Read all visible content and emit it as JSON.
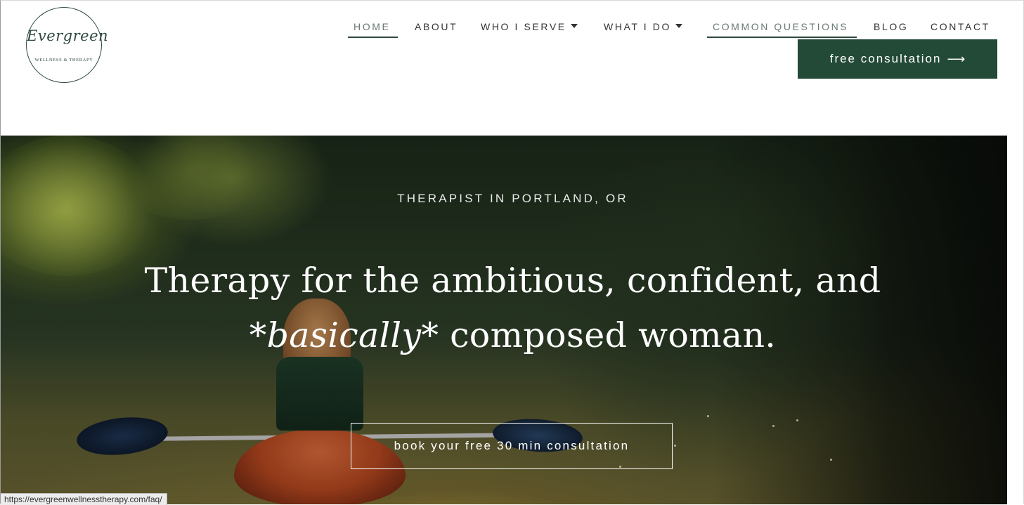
{
  "logo": {
    "script": "Evergreen",
    "subtitle": "WELLNESS & THERAPY"
  },
  "nav": {
    "items": [
      {
        "label": "HOME"
      },
      {
        "label": "ABOUT"
      },
      {
        "label": "WHO I SERVE"
      },
      {
        "label": "WHAT I DO"
      },
      {
        "label": "COMMON QUESTIONS"
      },
      {
        "label": "BLOG"
      },
      {
        "label": "CONTACT"
      }
    ],
    "cta_label": "free consultation",
    "cta_arrow": "⟶"
  },
  "hero": {
    "eyebrow": "THERAPIST IN PORTLAND, OR",
    "title_line1": "Therapy for the ambitious, confident, and",
    "title_line2_prefix": "*",
    "title_line2_emph": "basically",
    "title_line2_suffix": "* composed woman.",
    "button_label": "book your free 30 min consultation"
  },
  "status": {
    "url": "https://evergreenwellnesstherapy.com/faq/"
  },
  "colors": {
    "brand_green": "#234a37",
    "logo_ink": "#2e4a3e"
  }
}
